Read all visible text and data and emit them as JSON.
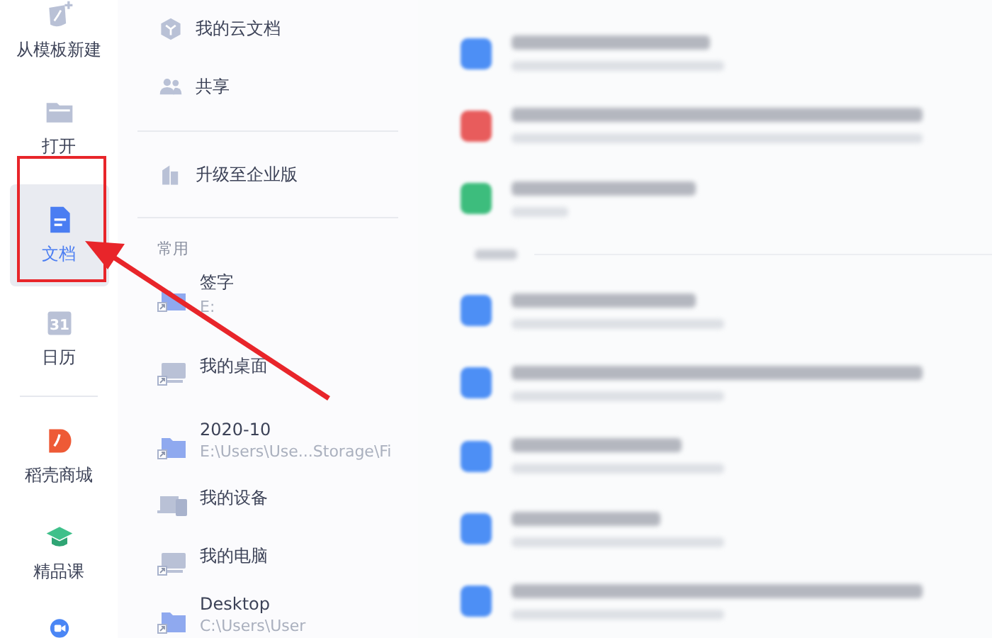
{
  "nav": [
    {
      "label": "从模板新建",
      "selected": false
    },
    {
      "label": "打开",
      "selected": false
    },
    {
      "label": "文档",
      "selected": true
    },
    {
      "label": "日历",
      "selected": false,
      "icon_text": "31"
    },
    {
      "label": "稻壳商城",
      "selected": false
    },
    {
      "label": "精品课",
      "selected": false
    }
  ],
  "cloud_items": [
    {
      "label": "我的云文档"
    },
    {
      "label": "共享"
    }
  ],
  "upgrade_item": {
    "label": "升级至企业版"
  },
  "common": {
    "title": "常用",
    "items": [
      {
        "name": "签字",
        "path": "E:"
      },
      {
        "name": "我的桌面"
      },
      {
        "name": "2020-10",
        "path": "E:\\Users\\Use...Storage\\Fi"
      },
      {
        "name": "我的设备"
      },
      {
        "name": "我的电脑"
      },
      {
        "name": "Desktop",
        "path": "C:\\Users\\User"
      }
    ]
  },
  "recent_files": [
    {
      "color": "#4d8ff5"
    },
    {
      "color": "#e85c5c"
    },
    {
      "color": "#3dbd7d"
    },
    {
      "color": "#4d8ff5"
    },
    {
      "color": "#4d8ff5"
    },
    {
      "color": "#4d8ff5"
    },
    {
      "color": "#4d8ff5"
    },
    {
      "color": "#4d8ff5"
    }
  ]
}
